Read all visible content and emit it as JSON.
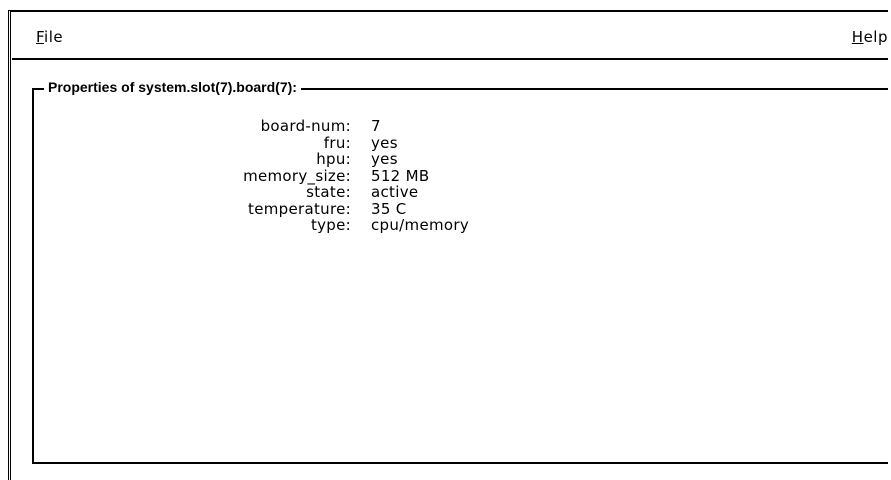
{
  "menubar": {
    "file_label": "File",
    "file_mnemonic": "F",
    "file_rest": "ile",
    "help_label": "Help",
    "help_mnemonic": "H",
    "help_rest": "elp"
  },
  "group": {
    "title": "Properties of system.slot(7).board(7):"
  },
  "properties": [
    {
      "key": "board-num:",
      "value": "7"
    },
    {
      "key": "fru:",
      "value": "yes"
    },
    {
      "key": "hpu:",
      "value": "yes"
    },
    {
      "key": "memory_size:",
      "value": "512 MB"
    },
    {
      "key": "state:",
      "value": "active"
    },
    {
      "key": "temperature:",
      "value": "35 C"
    },
    {
      "key": "type:",
      "value": "cpu/memory"
    }
  ]
}
